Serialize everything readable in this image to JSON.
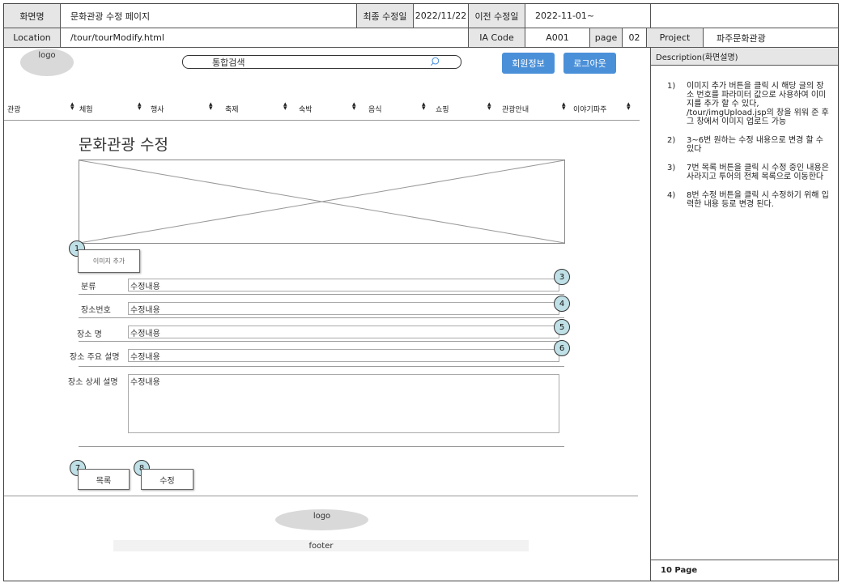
{
  "header": {
    "screen_name_label": "화면명",
    "screen_name": "문화관광 수정 페이지",
    "last_modified_label": "최종 수정일",
    "last_modified": "2022/11/22",
    "prev_modified_label": "이전 수정일",
    "prev_modified": "2022-11-01~",
    "location_label": "Location",
    "location": "/tour/tourModify.html",
    "ia_code_label": "IA Code",
    "ia_code": "A001",
    "page_label": "page",
    "page": "02",
    "project_label": "Project",
    "project": "파주문화관광"
  },
  "topbar": {
    "logo": "logo",
    "search_placeholder": "통합검색",
    "member_info": "회원정보",
    "logout": "로그아웃"
  },
  "nav": {
    "items": [
      "관광",
      "체험",
      "행사",
      "축제",
      "숙박",
      "음식",
      "쇼핑",
      "관광안내",
      "이야기파주"
    ]
  },
  "main": {
    "title": "문화관광 수정",
    "add_image": "이미지 추가",
    "fields": [
      {
        "label": "분류",
        "value": "수정내용"
      },
      {
        "label": "장소번호",
        "value": "수정내용"
      },
      {
        "label": "장소 명",
        "value": "수정내용"
      },
      {
        "label": "장소 주요 설명",
        "value": "수정내용"
      },
      {
        "label": "장소 상세 설명",
        "value": "수정내용"
      }
    ],
    "list_button": "목록",
    "modify_button": "수정",
    "markers": [
      "1",
      "3",
      "4",
      "5",
      "6",
      "7",
      "8"
    ]
  },
  "footer": {
    "logo": "logo",
    "text": "footer"
  },
  "side": {
    "heading": "Description(화면설명)",
    "items": [
      {
        "num": "1)",
        "text": "이미지 추가 버튼을 클릭 시 해당 글의 장소 번호를 파라미터 값으로 사용하여 이미지를 추가 할 수 있다, /tour/imgUpload.jsp의 창을 위워 준 후 그 창에서 이미지 업로드 가능"
      },
      {
        "num": "2)",
        "text": "3~6번 원하는 수정 내용으로 변경 할 수 있다"
      },
      {
        "num": "3)",
        "text": "7번 목록 버튼을 클릭 시 수정 중인 내용은 사라지고 투어의 전체 목록으로 이동한다"
      },
      {
        "num": "4)",
        "text": "8번 수정 버튼을 클릭 시 수정하기 위해 입력한 내용 등로 변경 된다."
      }
    ],
    "page_footer": "10 Page"
  }
}
